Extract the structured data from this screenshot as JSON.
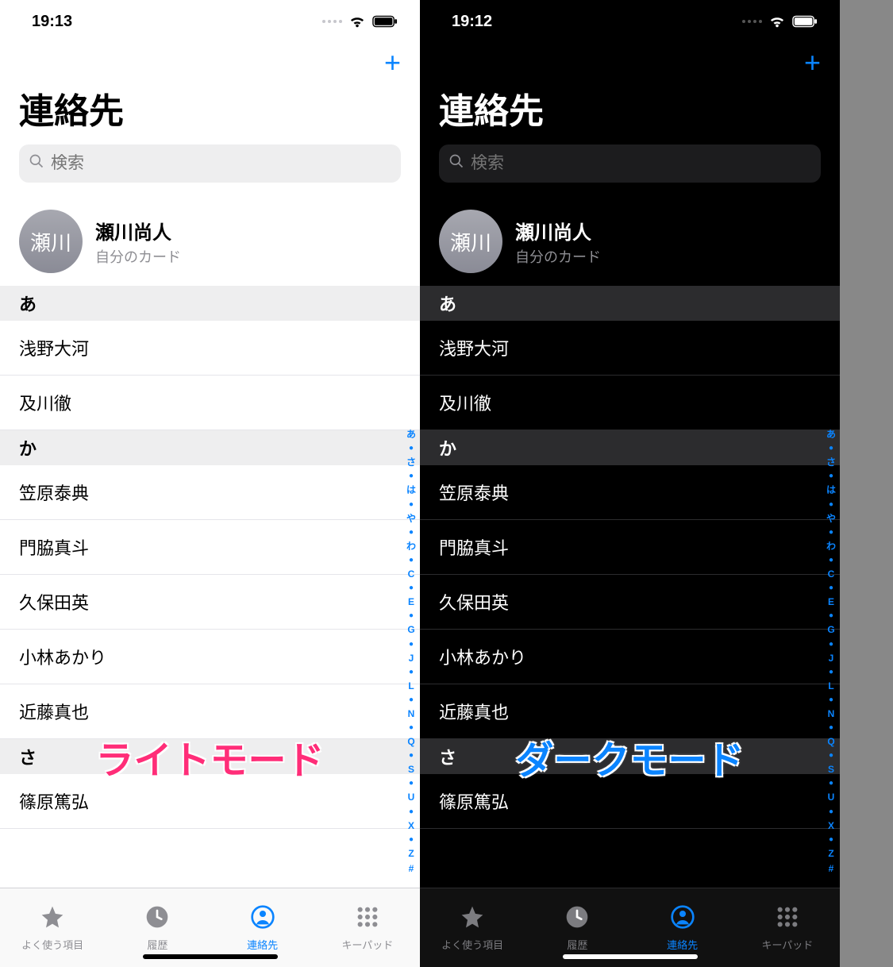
{
  "index_letters": [
    "あ",
    "●",
    "さ",
    "●",
    "は",
    "●",
    "や",
    "●",
    "わ",
    "●",
    "C",
    "●",
    "E",
    "●",
    "G",
    "●",
    "J",
    "●",
    "L",
    "●",
    "N",
    "●",
    "Q",
    "●",
    "S",
    "●",
    "U",
    "●",
    "X",
    "●",
    "Z",
    "#"
  ],
  "tabs": [
    {
      "key": "fav",
      "label": "よく使う項目"
    },
    {
      "key": "recent",
      "label": "履歴"
    },
    {
      "key": "contacts",
      "label": "連絡先"
    },
    {
      "key": "keypad",
      "label": "キーパッド"
    }
  ],
  "active_tab": "contacts",
  "light": {
    "time": "19:13",
    "title": "連絡先",
    "search_placeholder": "検索",
    "me": {
      "avatar": "瀬川",
      "name": "瀬川尚人",
      "sub": "自分のカード"
    },
    "sections": [
      {
        "letter": "あ",
        "rows": [
          "浅野大河",
          "及川徹"
        ]
      },
      {
        "letter": "か",
        "rows": [
          "笠原泰典",
          "門脇真斗",
          "久保田英",
          "小林あかり",
          "近藤真也"
        ]
      },
      {
        "letter": "さ",
        "rows": [
          "篠原篤弘"
        ]
      }
    ],
    "overlay": "ライトモード"
  },
  "dark": {
    "time": "19:12",
    "title": "連絡先",
    "search_placeholder": "検索",
    "me": {
      "avatar": "瀬川",
      "name": "瀬川尚人",
      "sub": "自分のカード"
    },
    "sections": [
      {
        "letter": "あ",
        "rows": [
          "浅野大河",
          "及川徹"
        ]
      },
      {
        "letter": "か",
        "rows": [
          "笠原泰典",
          "門脇真斗",
          "久保田英",
          "小林あかり",
          "近藤真也"
        ]
      },
      {
        "letter": "さ",
        "rows": [
          "篠原篤弘"
        ]
      }
    ],
    "overlay": "ダークモード"
  }
}
